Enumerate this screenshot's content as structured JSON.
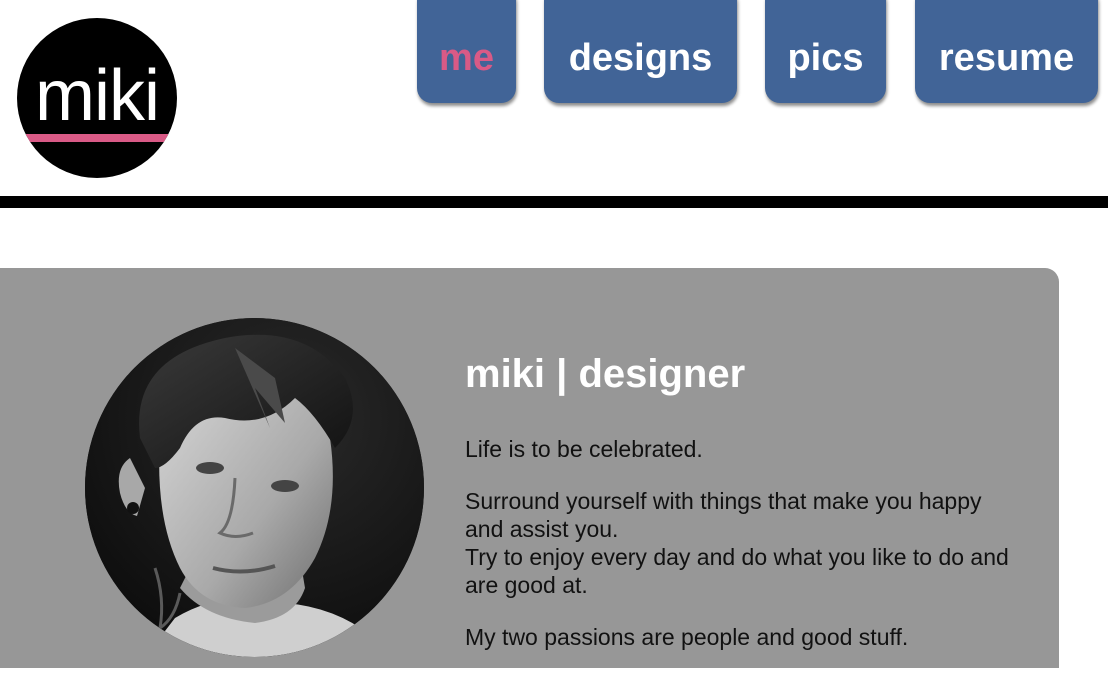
{
  "logo": {
    "text": "miki",
    "underline_color": "#d95a86"
  },
  "nav": {
    "active_color": "#d95a86",
    "tab_color": "#416497",
    "tabs": [
      {
        "label": "me",
        "active": true
      },
      {
        "label": "designs",
        "active": false
      },
      {
        "label": "pics",
        "active": false
      },
      {
        "label": "resume",
        "active": false
      }
    ]
  },
  "profile": {
    "heading": "miki | designer",
    "photo_icon": "profile-photo",
    "paragraphs": [
      "Life is to be celebrated.",
      "Surround yourself with things that make you happy and assist you.",
      "Try to enjoy every day and do what you like to do and are good at.",
      "My two passions are people and good stuff."
    ]
  }
}
